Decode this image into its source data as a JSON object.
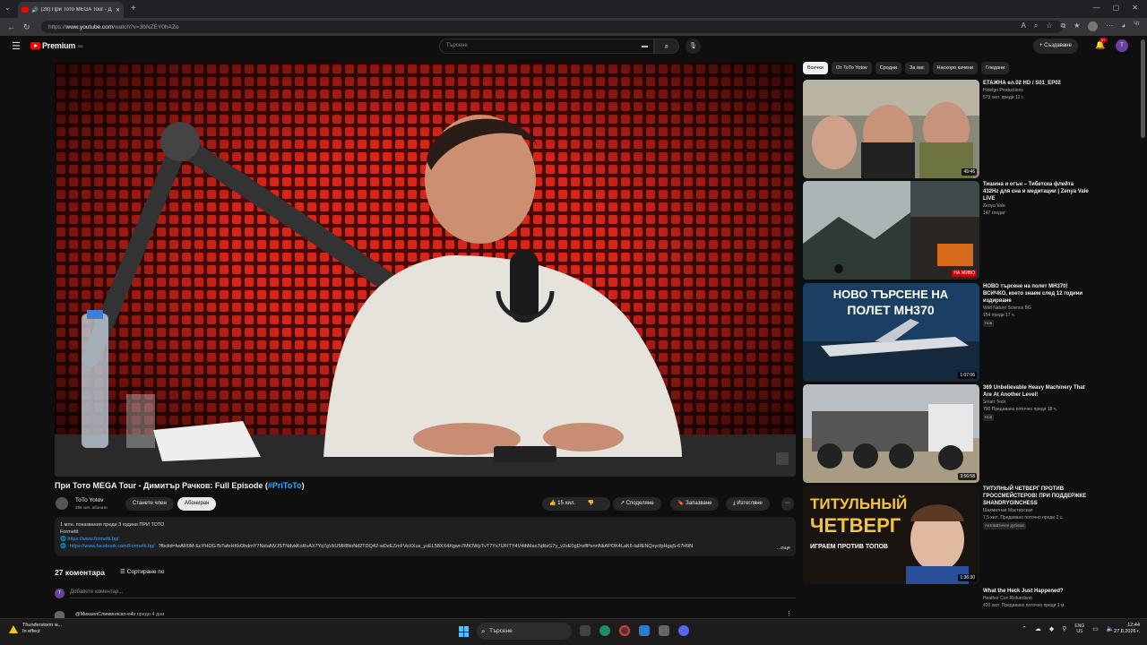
{
  "browser": {
    "tab_title": "(28) При Тото MEGA Tour - Д",
    "url_prefix": "https://",
    "url_host": "www.youtube.com",
    "url_path": "/watch?v=3bNZEY0hAZo",
    "profile_label": "Чт"
  },
  "header": {
    "logo": "Premium",
    "logo_region": "BG",
    "search_placeholder": "Търсене",
    "create_label": "Създаване",
    "notif_count": "9+",
    "avatar_letter": "T"
  },
  "video": {
    "title_main": "При Тото MEGA Tour - Димитър Рачков: Full Episode (",
    "title_hashtag": "#PriToTo",
    "title_end": ")",
    "channel_name": "ToTo Yotov",
    "channel_subs": "366 хил. абонати",
    "join_label": "Станете член",
    "subscribe_label": "Абониран",
    "likes": "15 хил.",
    "share_label": "Споделяне",
    "save_label": "Запазване",
    "download_label": "Изтегляне"
  },
  "description": {
    "stats": "1 млн. показвания  преди 3 години  ПРИ ТОТО",
    "line2": "Formetti:",
    "link1": "https://www.formetti.bg/",
    "link2": "https://www.facebook.com/Formetti.bg/",
    "long_text": "?fbclid=IwAR0M-EcYHOG7bTafeHKkOhdmY7NstaNVJSTNdvkKoRvAX7Yq7gVkUMRBtoNd2TDQ42-wDeEZmFVeXXus_ysEL58XX4Xgwn7MtOWpTvT7Yx7UFITY4V4thMax7qRzG7y_v2sE0gDrsflPennNkAPOK4LaK6-laRENQxycfpHgqS-67H9N",
    "more_label": "...още"
  },
  "comments": {
    "count": "27 коментара",
    "sort_label": "Сортиране по",
    "add_placeholder": "Добавете коментар...",
    "first_author": "@МихаелСлимоняско-е4v",
    "first_time": "преди 4 дни"
  },
  "chips": [
    "Всички",
    "От ToTo Yotov",
    "Сродни",
    "За вас",
    "Наскоро качени",
    "Гледани"
  ],
  "recommendations": [
    {
      "title": "ЕТАЖНА ел.02 HD / S01_EP02",
      "channel": "Hidelgo Productions",
      "meta": "573 хил.  преди 12 г.",
      "duration": "45:46",
      "badge": ""
    },
    {
      "title": "Тишина и огън – Тибетска флейта 432Hz для сна и медитации | Zenya Vale LIVE",
      "channel": "Zenya Vale",
      "meta": "147 гледат",
      "duration": "НА ЖИВО",
      "badge": ""
    },
    {
      "title": "НОВО търсене на полет MH370! ВСИЧКО, което знаем след 12 години издирване",
      "channel": "Wild Nature Science BG",
      "meta": "154  преди 17 ч.",
      "duration": "1:07:06",
      "badge": "Нов",
      "thumb_text1": "НОВО ТЪРСЕНЕ НА",
      "thumb_text2": "ПОЛЕТ MH370"
    },
    {
      "title": "369 Unbelievable Heavy Machinery That Are At Another Level!",
      "channel": "Smart Tech",
      "meta": "790  Предавано поточно преди 18 ч.",
      "duration": "3:56:58",
      "badge": "Нов"
    },
    {
      "title": "ТИТУЛНЫЙ ЧЕТВЕРГ ПРОТИВ ГРОССМЕЙСТЕРОВ! ПРИ ПОДДЕРЖКЕ SHANDRYGINCHESS",
      "channel": "Шахматная Мастерская",
      "meta": "7,5 хил.  Предавано поточно преди 2 с.",
      "duration": "1:36:30",
      "badge": "Автоматичен дублаж",
      "thumb_text1": "ТИТУЛЬНЫЙ",
      "thumb_text2": "ЧЕТВЕРГ",
      "thumb_text3": "ИГРАЕМ ПРОТИВ ТОПОВ"
    },
    {
      "title": "What the Heck Just Happened?",
      "channel": "Heather Cox Richardson",
      "meta": "420 хил.  Предавано поточно преди 1 м.",
      "duration": "",
      "badge": ""
    }
  ],
  "taskbar": {
    "weather_title": "Thunderstorm w...",
    "weather_sub": "In effect",
    "search_label": "Търсене",
    "lang1": "ENG",
    "lang2": "US",
    "time": "12:44",
    "date": "27.8.2026 г."
  }
}
